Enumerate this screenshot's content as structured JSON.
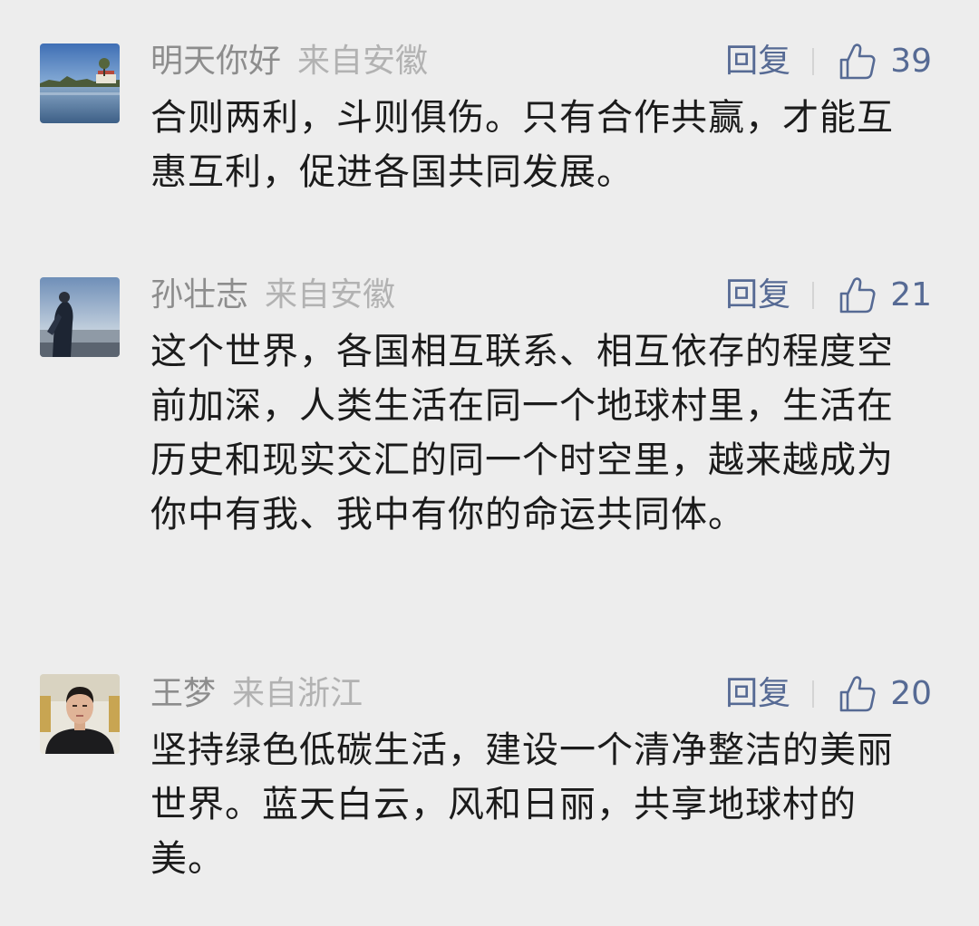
{
  "comments": [
    {
      "username": "明天你好",
      "location": "来自安徽",
      "reply_label": "回复",
      "likes": "39",
      "text": "合则两利，斗则俱伤。只有合作共赢，才能互惠互利，促进各国共同发展。"
    },
    {
      "username": "孙壮志",
      "location": "来自安徽",
      "reply_label": "回复",
      "likes": "21",
      "text": "这个世界，各国相互联系、相互依存的程度空前加深，人类生活在同一个地球村里，生活在历史和现实交汇的同一个时空里，越来越成为你中有我、我中有你的命运共同体。"
    },
    {
      "username": "王梦",
      "location": "来自浙江",
      "reply_label": "回复",
      "likes": "20",
      "text": "坚持绿色低碳生活，建设一个清净整洁的美丽世界。蓝天白云，风和日丽，共享地球村的美。"
    }
  ],
  "colors": {
    "background": "#ededed",
    "username": "#8d8d8d",
    "location": "#b2b2b2",
    "action": "#566a94",
    "body_text": "#1b1b1b"
  },
  "icons": {
    "like": "thumbs-up-icon",
    "avatar_1": "lake-scenery-avatar",
    "avatar_2": "person-by-water-avatar",
    "avatar_3": "man-portrait-avatar"
  }
}
